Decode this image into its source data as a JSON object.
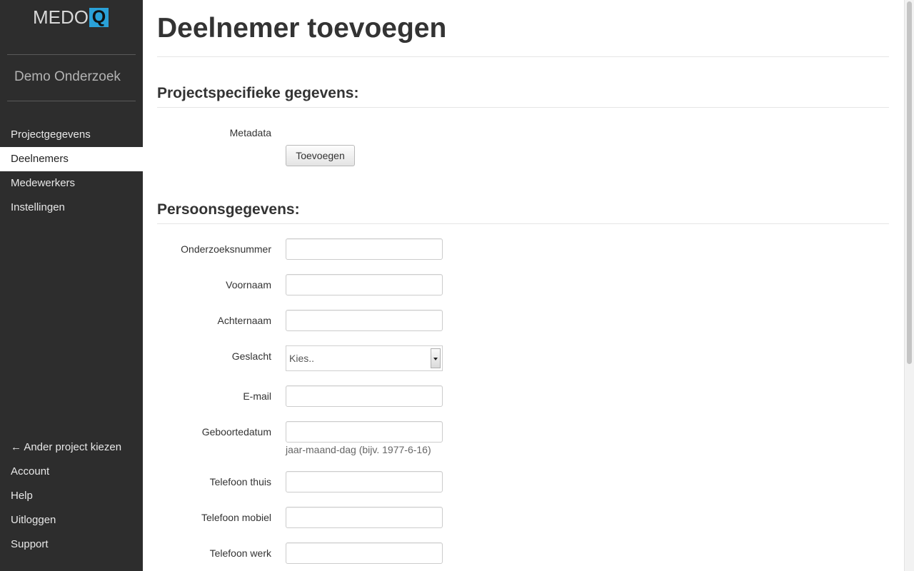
{
  "sidebar": {
    "logo_text": "MEDO",
    "logo_mark": "Q",
    "project_name": "Demo Onderzoek",
    "nav_items": [
      {
        "label": "Projectgegevens",
        "active": false
      },
      {
        "label": "Deelnemers",
        "active": true
      },
      {
        "label": "Medewerkers",
        "active": false
      },
      {
        "label": "Instellingen",
        "active": false
      }
    ],
    "bottom_items": [
      {
        "label": "← Ander project kiezen"
      },
      {
        "label": "Account"
      },
      {
        "label": "Help"
      },
      {
        "label": "Uitloggen"
      },
      {
        "label": "Support"
      }
    ]
  },
  "main": {
    "title": "Deelnemer toevoegen",
    "section_project": {
      "title": "Projectspecifieke gegevens:",
      "metadata_label": "Metadata",
      "add_button": "Toevoegen"
    },
    "section_person": {
      "title": "Persoonsgegevens:",
      "fields": {
        "onderzoeksnummer": {
          "label": "Onderzoeksnummer",
          "value": ""
        },
        "voornaam": {
          "label": "Voornaam",
          "value": ""
        },
        "achternaam": {
          "label": "Achternaam",
          "value": ""
        },
        "geslacht": {
          "label": "Geslacht",
          "selected": "Kies.."
        },
        "email": {
          "label": "E-mail",
          "value": ""
        },
        "geboortedatum": {
          "label": "Geboortedatum",
          "value": "",
          "help": "jaar-maand-dag (bijv. 1977-6-16)"
        },
        "telefoon_thuis": {
          "label": "Telefoon thuis",
          "value": ""
        },
        "telefoon_mobiel": {
          "label": "Telefoon mobiel",
          "value": ""
        },
        "telefoon_werk": {
          "label": "Telefoon werk",
          "value": ""
        }
      }
    }
  },
  "colors": {
    "sidebar_bg": "#2d2d2d",
    "logo_accent": "#2aa1d8",
    "active_nav_bg": "#ffffff"
  }
}
